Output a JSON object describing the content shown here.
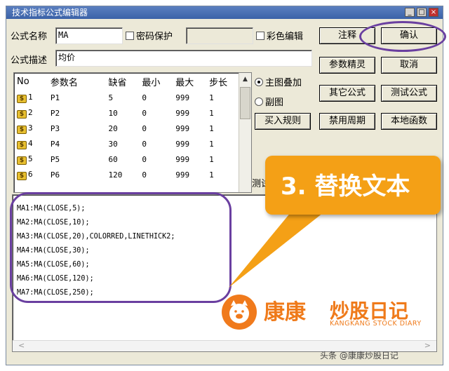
{
  "window": {
    "title": "技术指标公式编辑器"
  },
  "form": {
    "name_label": "公式名称",
    "name_value": "MA",
    "password_label": "密码保护",
    "color_edit_label": "彩色编辑",
    "desc_label": "公式描述",
    "desc_value": "均价"
  },
  "buttons": {
    "comment": "注释",
    "confirm": "确认",
    "param_wizard": "参数精灵",
    "cancel": "取消",
    "other_formula": "其它公式",
    "test_formula": "测试公式",
    "import_rule": "买入规则",
    "disable_period": "禁用周期",
    "local_function": "本地函数"
  },
  "placement": {
    "main_overlay": "主图叠加",
    "sub_chart": "副图",
    "test_label": "测试"
  },
  "params_table": {
    "headers": [
      "No",
      "参数名",
      "缺省",
      "最小",
      "最大",
      "步长"
    ],
    "rows": [
      {
        "no": "1",
        "name": "P1",
        "default": "5",
        "min": "0",
        "max": "999",
        "step": "1"
      },
      {
        "no": "2",
        "name": "P2",
        "default": "10",
        "min": "0",
        "max": "999",
        "step": "1"
      },
      {
        "no": "3",
        "name": "P3",
        "default": "20",
        "min": "0",
        "max": "999",
        "step": "1"
      },
      {
        "no": "4",
        "name": "P4",
        "default": "30",
        "min": "0",
        "max": "999",
        "step": "1"
      },
      {
        "no": "5",
        "name": "P5",
        "default": "60",
        "min": "0",
        "max": "999",
        "step": "1"
      },
      {
        "no": "6",
        "name": "P6",
        "default": "120",
        "min": "0",
        "max": "999",
        "step": "1"
      }
    ]
  },
  "code_lines": [
    "MA1:MA(CLOSE,5);",
    "MA2:MA(CLOSE,10);",
    "MA3:MA(CLOSE,20),COLORRED,LINETHICK2;",
    "MA4:MA(CLOSE,30);",
    "MA5:MA(CLOSE,60);",
    "MA6:MA(CLOSE,120);",
    "MA7:MA(CLOSE,250);"
  ],
  "callout": {
    "text": "3. 替换文本"
  },
  "brand": {
    "name_a": "康康",
    "name_b": "炒股日记",
    "english": "KANGKANG STOCK DIARY"
  },
  "watermark": "头条 @康康炒股日记",
  "colors": {
    "accent_orange": "#f4a016",
    "highlight_purple": "#6a3fa0",
    "brand_orange": "#ef7a1a"
  }
}
